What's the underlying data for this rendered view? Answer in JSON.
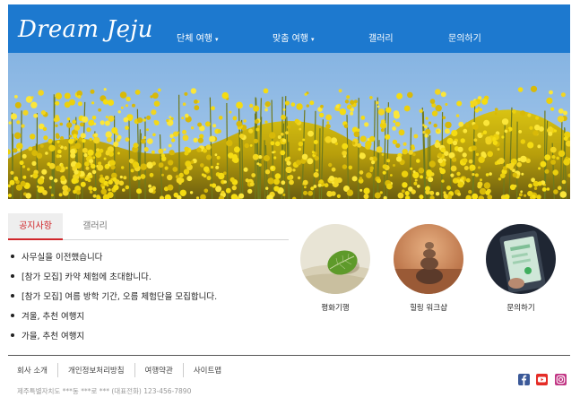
{
  "header": {
    "logo": "Dream Jeju",
    "nav": [
      {
        "label": "단체 여행",
        "caret": "▾"
      },
      {
        "label": "맞춤 여행",
        "caret": "▾"
      },
      {
        "label": "갤러리",
        "caret": ""
      },
      {
        "label": "문의하기",
        "caret": ""
      }
    ]
  },
  "tabs": [
    {
      "label": "공지사항",
      "active": true
    },
    {
      "label": "갤러리",
      "active": false
    }
  ],
  "notices": [
    "사무실을 이전했습니다",
    "[참가 모집] 카약 체험에 초대합니다.",
    "[참가 모집] 여름 방학 기간, 오름 체험단을 모집합니다.",
    "겨울, 추천 여행지",
    "가을, 추천 여행지"
  ],
  "cards": [
    {
      "label": "평화기행"
    },
    {
      "label": "힐링 워크샵"
    },
    {
      "label": "문의하기"
    }
  ],
  "footer": {
    "links": [
      "회사 소개",
      "개인정보처리방침",
      "여행약관",
      "사이트맵"
    ],
    "address": "제주특별자치도 ***동 ***로 *** (대표전화) 123-456-7890"
  },
  "colors": {
    "header_bg": "#1d79cf",
    "active_tab": "#d0262a",
    "facebook": "#3b5998",
    "youtube": "#e52d27",
    "instagram": "#c13584"
  },
  "icons": [
    "facebook-icon",
    "youtube-icon",
    "instagram-icon"
  ]
}
